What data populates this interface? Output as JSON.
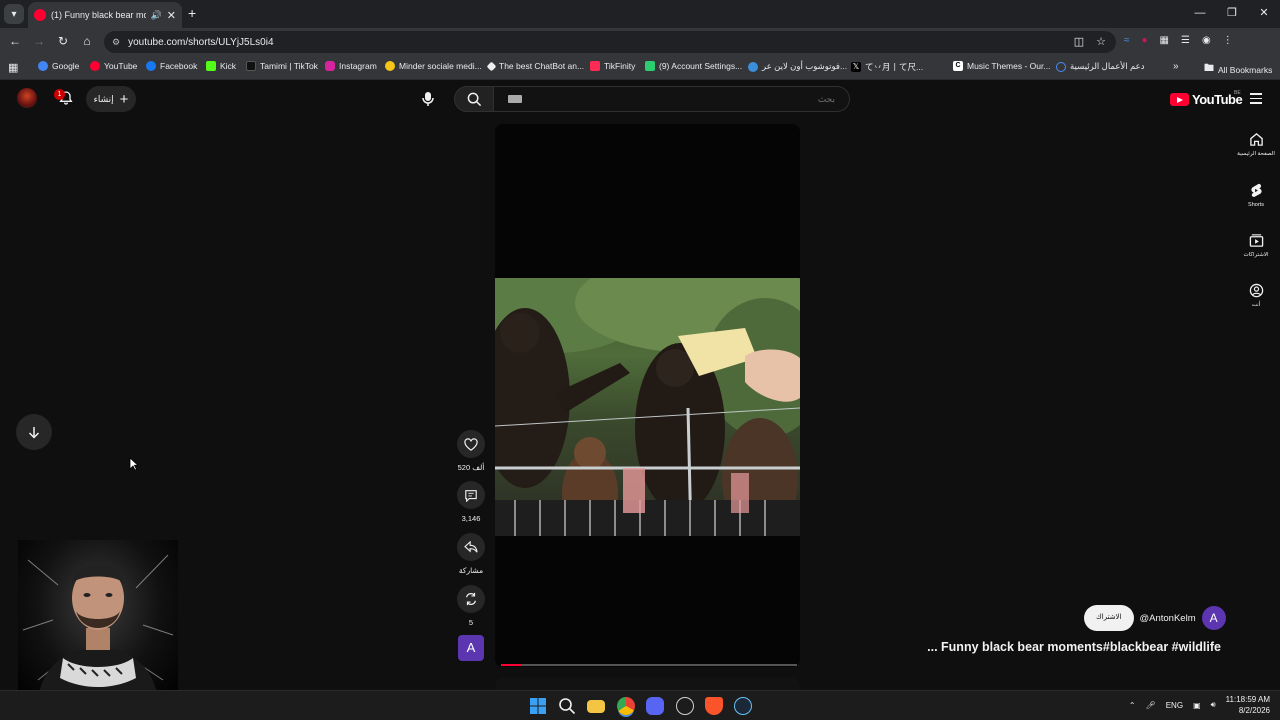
{
  "browser": {
    "tab": {
      "title": "(1) Funny black bear moments",
      "audio_icon": "🔊",
      "close": "✕"
    },
    "new_tab": "+",
    "window_controls": [
      "—",
      "❐",
      "✕"
    ],
    "url": "youtube.com/shorts/ULYjJ5Ls0i4",
    "bookmarks": [
      {
        "label": "Google",
        "color": "#4285f4"
      },
      {
        "label": "YouTube",
        "color": "#ff0033"
      },
      {
        "label": "Facebook",
        "color": "#1877f2"
      },
      {
        "label": "Kick",
        "color": "#53fc18"
      },
      {
        "label": "Tamimi | TikTok",
        "color": "#111111"
      },
      {
        "label": "Instagram",
        "color": "#d6249f"
      },
      {
        "label": "Minder sociale medi...",
        "color": "#f5c518"
      },
      {
        "label": "The best ChatBot an...",
        "color": "#eeeeee"
      },
      {
        "label": "TikFinity",
        "color": "#fe2c55"
      },
      {
        "label": "(9) Account Settings...",
        "color": "#2ecc71"
      },
      {
        "label": "فوتوشوب أون لاين عر...",
        "color": "#3b8fd9"
      },
      {
        "label": "て丷月丨て尺...",
        "color": "#000000"
      },
      {
        "label": "Music Themes - Our...",
        "color": "#ffffff"
      },
      {
        "label": "دعم الأعمال الرئيسية",
        "color": "#4c8bf5"
      }
    ],
    "all_bookmarks": "All Bookmarks"
  },
  "yt": {
    "notification_count": "1",
    "create_label": "إنشاء",
    "search_placeholder": "بحث",
    "logo_text": "YouTube",
    "region": "BE",
    "guide": [
      {
        "label": "الصفحة الرئيسية",
        "icon": "home-icon"
      },
      {
        "label": "Shorts",
        "icon": "shorts-icon"
      },
      {
        "label": "الاشتراكات",
        "icon": "subscriptions-icon"
      },
      {
        "label": "أنت",
        "icon": "you-icon"
      }
    ]
  },
  "short": {
    "likes": "520 ألف",
    "comments": "3,146",
    "share": "مشاركة",
    "remix": "5",
    "channel_initial": "A",
    "subscribe": "الاشتراك",
    "channel": "@AntonKelm",
    "title": "... Funny black bear moments#blackbear #wildlife",
    "progress": 0.07
  },
  "taskbar": {
    "lang": "ENG",
    "time": "11:18:59 AM",
    "date": "8/2/2026"
  }
}
